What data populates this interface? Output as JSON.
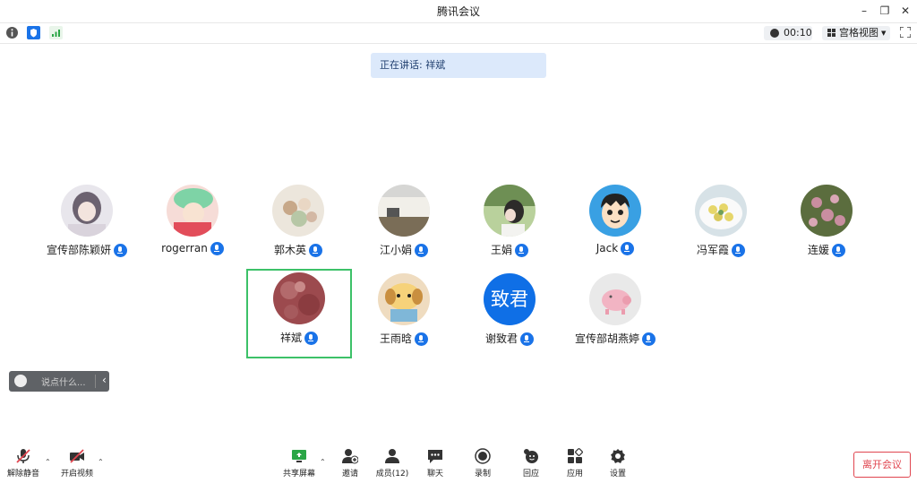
{
  "window": {
    "title": "腾讯会议"
  },
  "topbar": {
    "timer": "00:10",
    "view_label": "宫格视图"
  },
  "speaking": {
    "text": "正在讲话: 祥斌"
  },
  "participants": [
    {
      "name": "宣传部陈颖妍"
    },
    {
      "name": "rogerran"
    },
    {
      "name": "郭木英"
    },
    {
      "name": "江小娟"
    },
    {
      "name": "王娟"
    },
    {
      "name": "Jack"
    },
    {
      "name": "冯军霞"
    },
    {
      "name": "连媛"
    },
    {
      "name": "祥斌"
    },
    {
      "name": "王雨晗"
    },
    {
      "name": "谢致君",
      "avatar_text": "致君"
    },
    {
      "name": "宣传部胡燕婷"
    }
  ],
  "chat": {
    "placeholder": "说点什么..."
  },
  "bottombar": {
    "unmute": "解除静音",
    "video": "开启视频",
    "share": "共享屏幕",
    "invite": "邀请",
    "members": "成员(12)",
    "chat": "聊天",
    "record": "录制",
    "replay": "回应",
    "apps": "应用",
    "settings": "设置",
    "leave": "离开会议"
  },
  "colors": {
    "accent": "#1a73e8",
    "active_border": "#3cc168",
    "leave": "#e0454f"
  }
}
